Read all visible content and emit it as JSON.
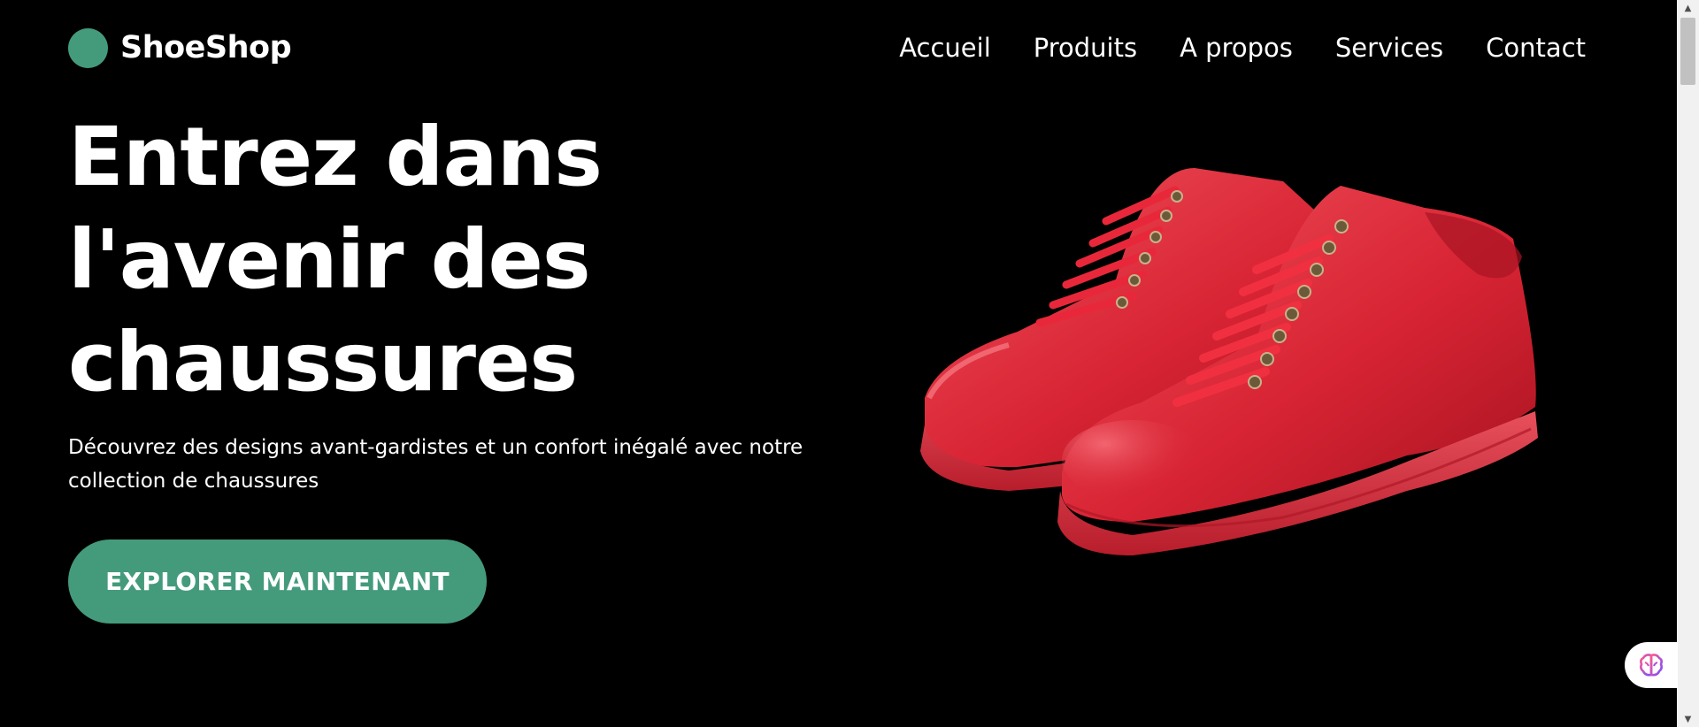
{
  "brand": {
    "name": "ShoeShop",
    "logo_color": "#449b7c"
  },
  "nav": {
    "items": [
      "Accueil",
      "Produits",
      "A propos",
      "Services",
      "Contact"
    ]
  },
  "hero": {
    "title_lines": [
      "Entrez dans",
      "l'avenir des",
      "chaussures"
    ],
    "subtitle_lines": [
      "Découvrez des designs avant-gardistes et un confort inégalé avec notre",
      "collection de chaussures"
    ],
    "cta_label": "EXPLORER MAINTENANT",
    "cta_color": "#449b7c",
    "image_subject": "red-sneakers-pair"
  },
  "colors": {
    "background": "#000000",
    "text": "#ffffff",
    "shoe_red": "#e02a38"
  },
  "widgets": {
    "floating_icon": "brain-icon"
  }
}
